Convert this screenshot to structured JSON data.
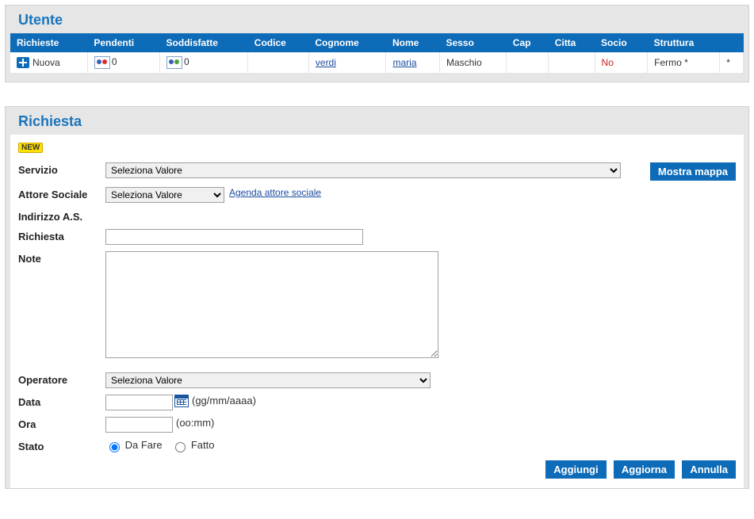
{
  "utente": {
    "title": "Utente",
    "headers": [
      "Richieste",
      "Pendenti",
      "Soddisfatte",
      "Codice",
      "Cognome",
      "Nome",
      "Sesso",
      "Cap",
      "Citta",
      "Socio",
      "Struttura"
    ],
    "row": {
      "richieste_label": "Nuova",
      "pendenti_count": "0",
      "soddisfatte_count": "0",
      "codice": "",
      "cognome": "verdi",
      "nome": "maria",
      "sesso": "Maschio",
      "cap": "",
      "citta": "",
      "socio": "No",
      "struttura": "Fermo *",
      "extra": "*"
    }
  },
  "richiesta": {
    "title": "Richiesta",
    "new_badge": "NEW",
    "labels": {
      "servizio": "Servizio",
      "attore_sociale": "Attore Sociale",
      "indirizzo_as": "Indirizzo A.S.",
      "richiesta": "Richiesta",
      "note": "Note",
      "operatore": "Operatore",
      "data": "Data",
      "ora": "Ora",
      "stato": "Stato"
    },
    "placeholder_select": "Seleziona Valore",
    "agenda_link": "Agenda attore sociale",
    "mostra_mappa": "Mostra mappa",
    "data_hint": "(gg/mm/aaaa)",
    "ora_hint": "(oo:mm)",
    "stato_options": {
      "da_fare": "Da Fare",
      "fatto": "Fatto"
    },
    "actions": {
      "aggiungi": "Aggiungi",
      "aggiorna": "Aggiorna",
      "annulla": "Annulla"
    }
  }
}
